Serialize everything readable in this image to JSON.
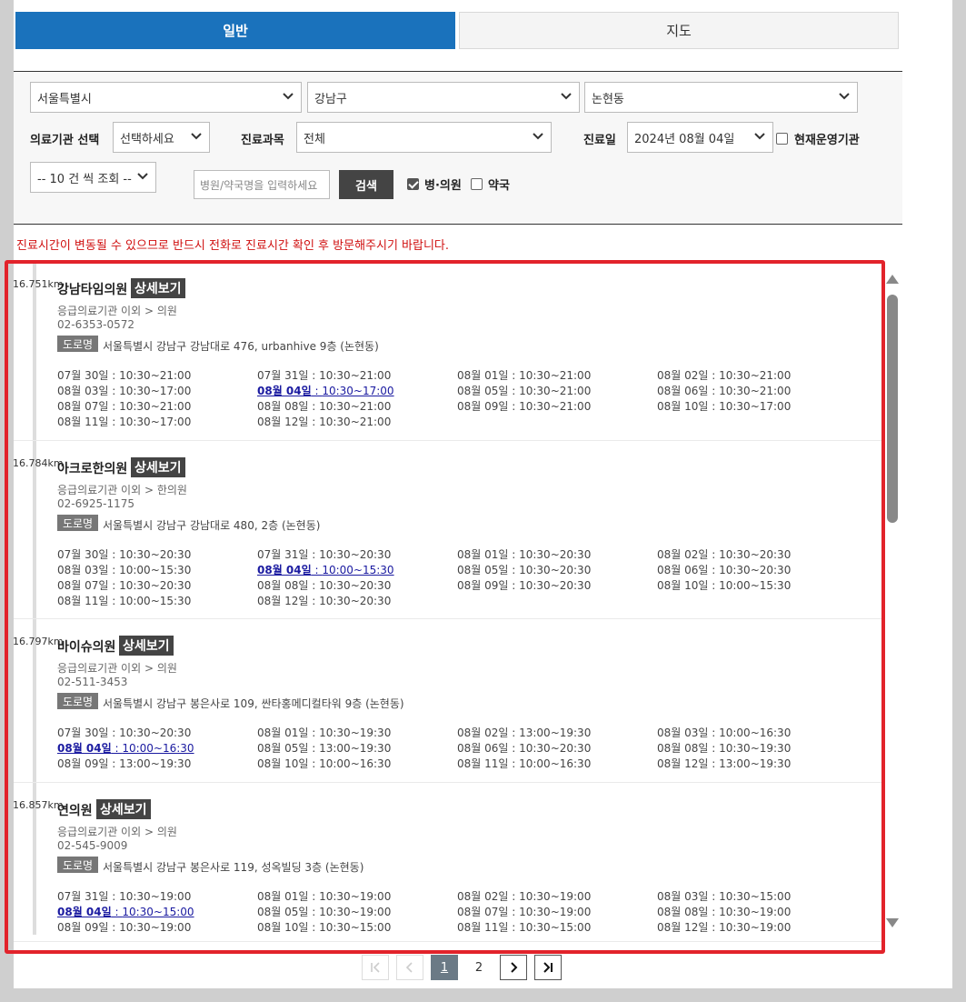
{
  "tabs": {
    "general": "일반",
    "map": "지도"
  },
  "filters": {
    "city": "서울특별시",
    "district": "강남구",
    "dong": "논현동",
    "facility_label": "의료기관 선택",
    "facility_value": "선택하세요",
    "department_label": "진료과목",
    "department_value": "전체",
    "date_label": "진료일",
    "date_value": "2024년 08월 04일",
    "operating_label": "현재운영기관",
    "page_size": "-- 10 건 씩 조회 --",
    "search_placeholder": "병원/약국명을 입력하세요",
    "search_button": "검색",
    "clinic_label": "병·의원",
    "pharmacy_label": "약국"
  },
  "notice": "진료시간이 변동될 수 있으므로 반드시 전화로 진료시간 확인 후 방문해주시기 바랍니다.",
  "detail_label": "상세보기",
  "road_label": "도로명",
  "results": [
    {
      "distance": "16.751km",
      "name": "강남타임의원",
      "category": "응급의료기관 이외 > 의원",
      "phone": "02-6353-0572",
      "address": "서울특별시 강남구 강남대로 476, urbanhive 9층 (논현동)",
      "hours": [
        {
          "day": "07월 30일",
          "time": "10:30~21:00"
        },
        {
          "day": "07월 31일",
          "time": "10:30~21:00"
        },
        {
          "day": "08월 01일",
          "time": "10:30~21:00"
        },
        {
          "day": "08월 02일",
          "time": "10:30~21:00"
        },
        {
          "day": "08월 03일",
          "time": "10:30~17:00"
        },
        {
          "day": "08월 04일",
          "time": "10:30~17:00",
          "today": true
        },
        {
          "day": "08월 05일",
          "time": "10:30~21:00"
        },
        {
          "day": "08월 06일",
          "time": "10:30~21:00"
        },
        {
          "day": "08월 07일",
          "time": "10:30~21:00"
        },
        {
          "day": "08월 08일",
          "time": "10:30~21:00"
        },
        {
          "day": "08월 09일",
          "time": "10:30~21:00"
        },
        {
          "day": "08월 10일",
          "time": "10:30~17:00"
        },
        {
          "day": "08월 11일",
          "time": "10:30~17:00"
        },
        {
          "day": "08월 12일",
          "time": "10:30~21:00"
        }
      ]
    },
    {
      "distance": "16.784km",
      "name": "아크로한의원",
      "category": "응급의료기관 이외 > 한의원",
      "phone": "02-6925-1175",
      "address": "서울특별시 강남구 강남대로 480, 2층 (논현동)",
      "hours": [
        {
          "day": "07월 30일",
          "time": "10:30~20:30"
        },
        {
          "day": "07월 31일",
          "time": "10:30~20:30"
        },
        {
          "day": "08월 01일",
          "time": "10:30~20:30"
        },
        {
          "day": "08월 02일",
          "time": "10:30~20:30"
        },
        {
          "day": "08월 03일",
          "time": "10:00~15:30"
        },
        {
          "day": "08월 04일",
          "time": "10:00~15:30",
          "today": true
        },
        {
          "day": "08월 05일",
          "time": "10:30~20:30"
        },
        {
          "day": "08월 06일",
          "time": "10:30~20:30"
        },
        {
          "day": "08월 07일",
          "time": "10:30~20:30"
        },
        {
          "day": "08월 08일",
          "time": "10:30~20:30"
        },
        {
          "day": "08월 09일",
          "time": "10:30~20:30"
        },
        {
          "day": "08월 10일",
          "time": "10:00~15:30"
        },
        {
          "day": "08월 11일",
          "time": "10:00~15:30"
        },
        {
          "day": "08월 12일",
          "time": "10:30~20:30"
        }
      ]
    },
    {
      "distance": "16.797km",
      "name": "바이슈의원",
      "category": "응급의료기관 이외 > 의원",
      "phone": "02-511-3453",
      "address": "서울특별시 강남구 봉은사로 109, 싼타홍메디컬타워 9층 (논현동)",
      "hours": [
        {
          "day": "07월 30일",
          "time": "10:30~20:30"
        },
        {
          "day": "08월 01일",
          "time": "10:30~19:30"
        },
        {
          "day": "08월 02일",
          "time": "13:00~19:30"
        },
        {
          "day": "08월 03일",
          "time": "10:00~16:30"
        },
        {
          "day": "08월 04일",
          "time": "10:00~16:30",
          "today": true
        },
        {
          "day": "08월 05일",
          "time": "13:00~19:30"
        },
        {
          "day": "08월 06일",
          "time": "10:30~20:30"
        },
        {
          "day": "08월 08일",
          "time": "10:30~19:30"
        },
        {
          "day": "08월 09일",
          "time": "13:00~19:30"
        },
        {
          "day": "08월 10일",
          "time": "10:00~16:30"
        },
        {
          "day": "08월 11일",
          "time": "10:00~16:30"
        },
        {
          "day": "08월 12일",
          "time": "13:00~19:30"
        }
      ]
    },
    {
      "distance": "16.857km",
      "name": "연의원",
      "category": "응급의료기관 이외 > 의원",
      "phone": "02-545-9009",
      "address": "서울특별시 강남구 봉은사로 119, 성옥빌딩 3층 (논현동)",
      "hours": [
        {
          "day": "07월 31일",
          "time": "10:30~19:00"
        },
        {
          "day": "08월 01일",
          "time": "10:30~19:00"
        },
        {
          "day": "08월 02일",
          "time": "10:30~19:00"
        },
        {
          "day": "08월 03일",
          "time": "10:30~15:00"
        },
        {
          "day": "08월 04일",
          "time": "10:30~15:00",
          "today": true
        },
        {
          "day": "08월 05일",
          "time": "10:30~19:00"
        },
        {
          "day": "08월 07일",
          "time": "10:30~19:00"
        },
        {
          "day": "08월 08일",
          "time": "10:30~19:00"
        },
        {
          "day": "08월 09일",
          "time": "10:30~19:00"
        },
        {
          "day": "08월 10일",
          "time": "10:30~15:00"
        },
        {
          "day": "08월 11일",
          "time": "10:30~15:00"
        },
        {
          "day": "08월 12일",
          "time": "10:30~19:00"
        }
      ]
    }
  ],
  "pagination": {
    "pages": [
      "1",
      "2"
    ],
    "current": "1"
  },
  "colors": {
    "accent": "#1a72bc",
    "highlight": "#e2232b",
    "notice": "#d01010"
  }
}
